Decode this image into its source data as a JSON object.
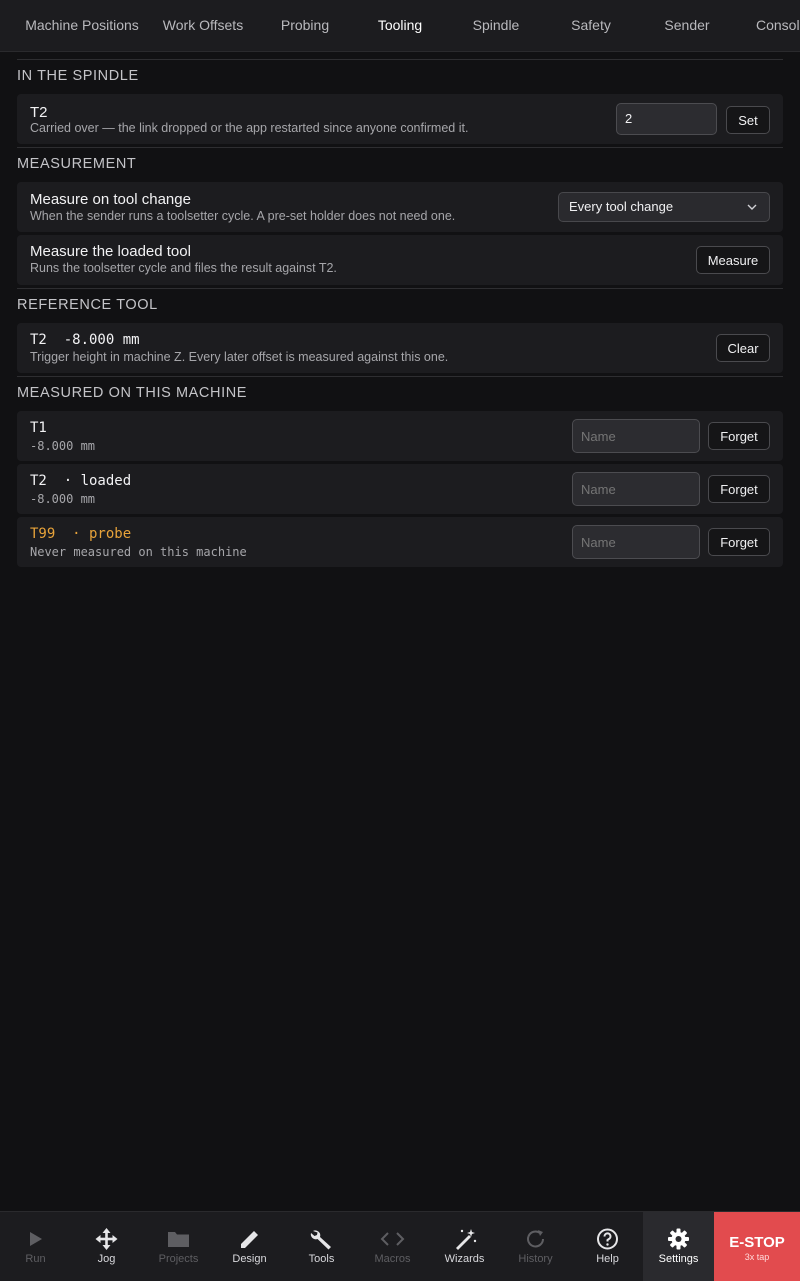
{
  "tabs": [
    {
      "label": "Machine Positions"
    },
    {
      "label": "Work Offsets"
    },
    {
      "label": "Probing"
    },
    {
      "label": "Tooling"
    },
    {
      "label": "Spindle"
    },
    {
      "label": "Safety"
    },
    {
      "label": "Sender"
    },
    {
      "label": "Console"
    }
  ],
  "active_tab": "Tooling",
  "spindle": {
    "heading": "IN THE SPINDLE",
    "tool": "T2",
    "note": "Carried over — the link dropped or the app restarted since anyone confirmed it.",
    "input_value": "2",
    "set_label": "Set"
  },
  "measurement": {
    "heading": "MEASUREMENT",
    "on_change_title": "Measure on tool change",
    "on_change_sub": "When the sender runs a toolsetter cycle. A pre-set holder does not need one.",
    "on_change_value": "Every tool change",
    "loaded_title": "Measure the loaded tool",
    "loaded_sub": "Runs the toolsetter cycle and files the result against T2.",
    "measure_label": "Measure"
  },
  "reference": {
    "heading": "REFERENCE TOOL",
    "title": "T2  -8.000 mm",
    "sub": "Trigger height in machine Z. Every later offset is measured against this one.",
    "clear_label": "Clear"
  },
  "measured": {
    "heading": "MEASURED ON THIS MACHINE",
    "tools": [
      {
        "title": "T1",
        "sub": "-8.000 mm",
        "placeholder": "Name",
        "forget": "Forget"
      },
      {
        "title": "T2  · loaded",
        "sub": "-8.000 mm",
        "placeholder": "Name",
        "forget": "Forget"
      },
      {
        "title": "T99  · probe",
        "sub": "Never measured on this machine",
        "placeholder": "Name",
        "forget": "Forget"
      }
    ]
  },
  "bottom_nav": [
    {
      "label": "Run",
      "icon": "play-icon"
    },
    {
      "label": "Jog",
      "icon": "move-arrows-icon"
    },
    {
      "label": "Projects",
      "icon": "folder-icon"
    },
    {
      "label": "Design",
      "icon": "pencil-icon"
    },
    {
      "label": "Tools",
      "icon": "wrench-icon"
    },
    {
      "label": "Macros",
      "icon": "code-icon"
    },
    {
      "label": "Wizards",
      "icon": "magic-wand-icon"
    },
    {
      "label": "History",
      "icon": "refresh-icon"
    },
    {
      "label": "Help",
      "icon": "help-circle-icon"
    },
    {
      "label": "Settings",
      "icon": "gear-icon"
    }
  ],
  "estop": {
    "label": "E-STOP",
    "sub": "3x tap"
  },
  "colors": {
    "accent_orange": "#e8a33a",
    "estop_red": "#e24b4e",
    "background": "#111113",
    "card": "#1c1c1f"
  }
}
